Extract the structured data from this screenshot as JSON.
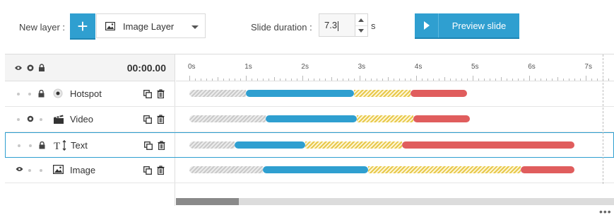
{
  "toolbar": {
    "new_layer_label": "New layer :",
    "add_symbol": "+",
    "layer_type_selected": "Image Layer",
    "duration_label": "Slide duration :",
    "duration_value": "7.3",
    "duration_unit": "s",
    "preview_label": "Preview slide"
  },
  "timeline": {
    "time_display": "00:00.00",
    "ruler_labels": [
      "0s",
      "1s",
      "2s",
      "3s",
      "4s",
      "5s",
      "6s",
      "7s"
    ],
    "layers": [
      {
        "name": "Hotspot",
        "type_icon": "hotspot-icon",
        "visible": false,
        "solo": false,
        "locked": true,
        "selected": false,
        "segments": {
          "delay": [
            0,
            1.0
          ],
          "in": [
            1.0,
            2.9
          ],
          "static": [
            2.9,
            3.9
          ],
          "out": [
            3.9,
            4.9
          ]
        }
      },
      {
        "name": "Video",
        "type_icon": "video-clapper-icon",
        "visible": false,
        "solo": true,
        "locked": false,
        "selected": false,
        "segments": {
          "delay": [
            0,
            1.35
          ],
          "in": [
            1.35,
            2.95
          ],
          "static": [
            2.95,
            3.95
          ],
          "out": [
            3.95,
            4.95
          ]
        }
      },
      {
        "name": "Text",
        "type_icon": "text-icon",
        "visible": false,
        "solo": false,
        "locked": true,
        "selected": true,
        "segments": {
          "delay": [
            0,
            0.8
          ],
          "in": [
            0.8,
            2.05
          ],
          "static": [
            2.05,
            3.75
          ],
          "out": [
            3.75,
            6.8
          ]
        }
      },
      {
        "name": "Image",
        "type_icon": "image-icon",
        "visible": true,
        "solo": false,
        "locked": false,
        "selected": false,
        "segments": {
          "delay": [
            0,
            1.3
          ],
          "in": [
            1.3,
            3.15
          ],
          "static": [
            3.15,
            5.85
          ],
          "out": [
            5.85,
            6.8
          ]
        }
      }
    ],
    "more_label": "•••"
  },
  "colors": {
    "accent": "#2f9fd0",
    "in_bar": "#2f9fd0",
    "out_bar": "#e05d5d",
    "static_hatch": "#e8c84a",
    "delay_hatch": "#c9c9c9"
  }
}
